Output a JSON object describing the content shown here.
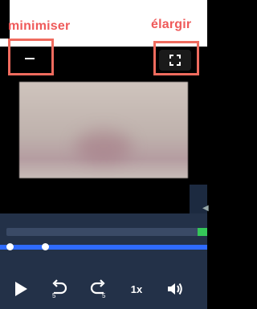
{
  "annotations": {
    "minimize_label": "minimiser",
    "expand_label": "élargir"
  },
  "player": {
    "speed_label": "1x",
    "rewind_seconds": "5",
    "forward_seconds": "5"
  },
  "colors": {
    "annotation": "#ef5a5a",
    "controls_bg": "#233148",
    "progress_blue": "#2f6bff",
    "buffer_green": "#35c759"
  },
  "icons": [
    "minimize-icon",
    "expand-icon",
    "play-icon",
    "rewind-5-icon",
    "forward-5-icon",
    "volume-icon"
  ]
}
